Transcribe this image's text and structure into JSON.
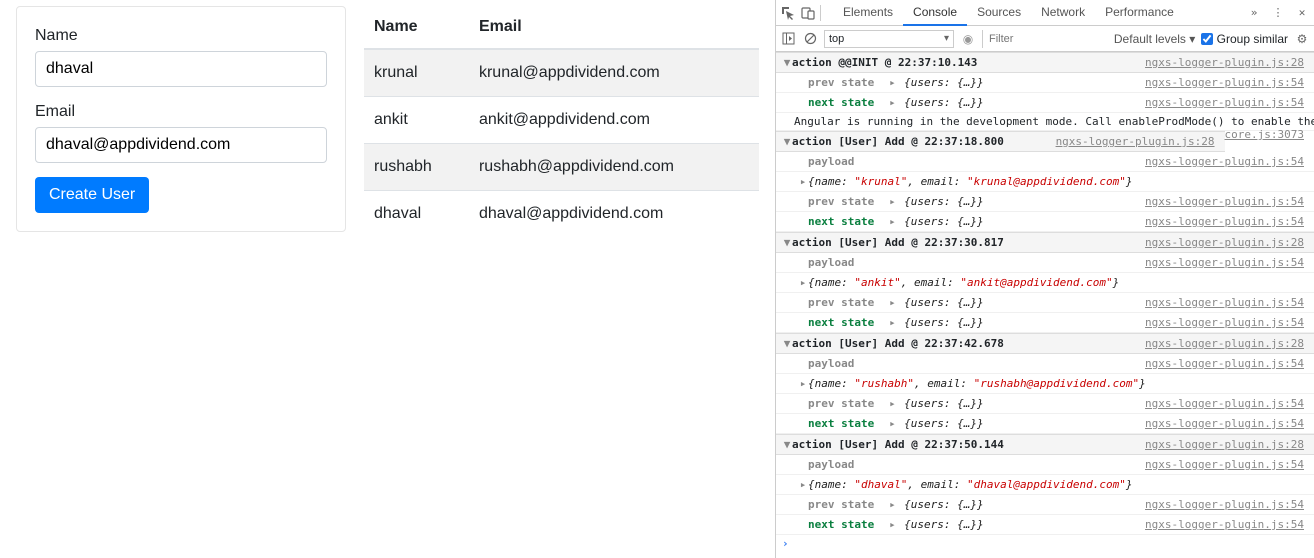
{
  "form": {
    "name_label": "Name",
    "name_value": "dhaval",
    "email_label": "Email",
    "email_value": "dhaval@appdividend.com",
    "submit_label": "Create User"
  },
  "table": {
    "headers": {
      "name": "Name",
      "email": "Email"
    },
    "rows": [
      {
        "name": "krunal",
        "email": "krunal@appdividend.com"
      },
      {
        "name": "ankit",
        "email": "ankit@appdividend.com"
      },
      {
        "name": "rushabh",
        "email": "rushabh@appdividend.com"
      },
      {
        "name": "dhaval",
        "email": "dhaval@appdividend.com"
      }
    ]
  },
  "devtools": {
    "tabs": {
      "elements": "Elements",
      "console": "Console",
      "sources": "Sources",
      "network": "Network",
      "performance": "Performance"
    },
    "context": "top",
    "filter_placeholder": "Filter",
    "levels_label": "Default levels ▾",
    "group_label": "Group similar",
    "angular_msg": "Angular is running in the development mode. Call enableProdMode() to enable the production mode.",
    "angular_src": "core.js:3073",
    "plugin28": "ngxs-logger-plugin.js:28",
    "plugin54": "ngxs-logger-plugin.js:54",
    "prev_label": "prev state",
    "next_label": "next state",
    "payload_label": "payload",
    "users_obj": "{users: {…}}",
    "actions": [
      {
        "title": "action @@INIT @ 22:37:10.143",
        "payload": null,
        "prev": true,
        "next": true,
        "angular_after_next": true
      },
      {
        "title": "action [User] Add @ 22:37:18.800",
        "payload": "{name: \"krunal\", email: \"krunal@appdividend.com\"}",
        "prev": true,
        "next": true
      },
      {
        "title": "action [User] Add @ 22:37:30.817",
        "payload": "{name: \"ankit\", email: \"ankit@appdividend.com\"}",
        "prev": true,
        "next": true
      },
      {
        "title": "action [User] Add @ 22:37:42.678",
        "payload": "{name: \"rushabh\", email: \"rushabh@appdividend.com\"}",
        "prev": true,
        "next": true
      },
      {
        "title": "action [User] Add @ 22:37:50.144",
        "payload": "{name: \"dhaval\", email: \"dhaval@appdividend.com\"}",
        "prev": true,
        "next": true
      }
    ]
  }
}
